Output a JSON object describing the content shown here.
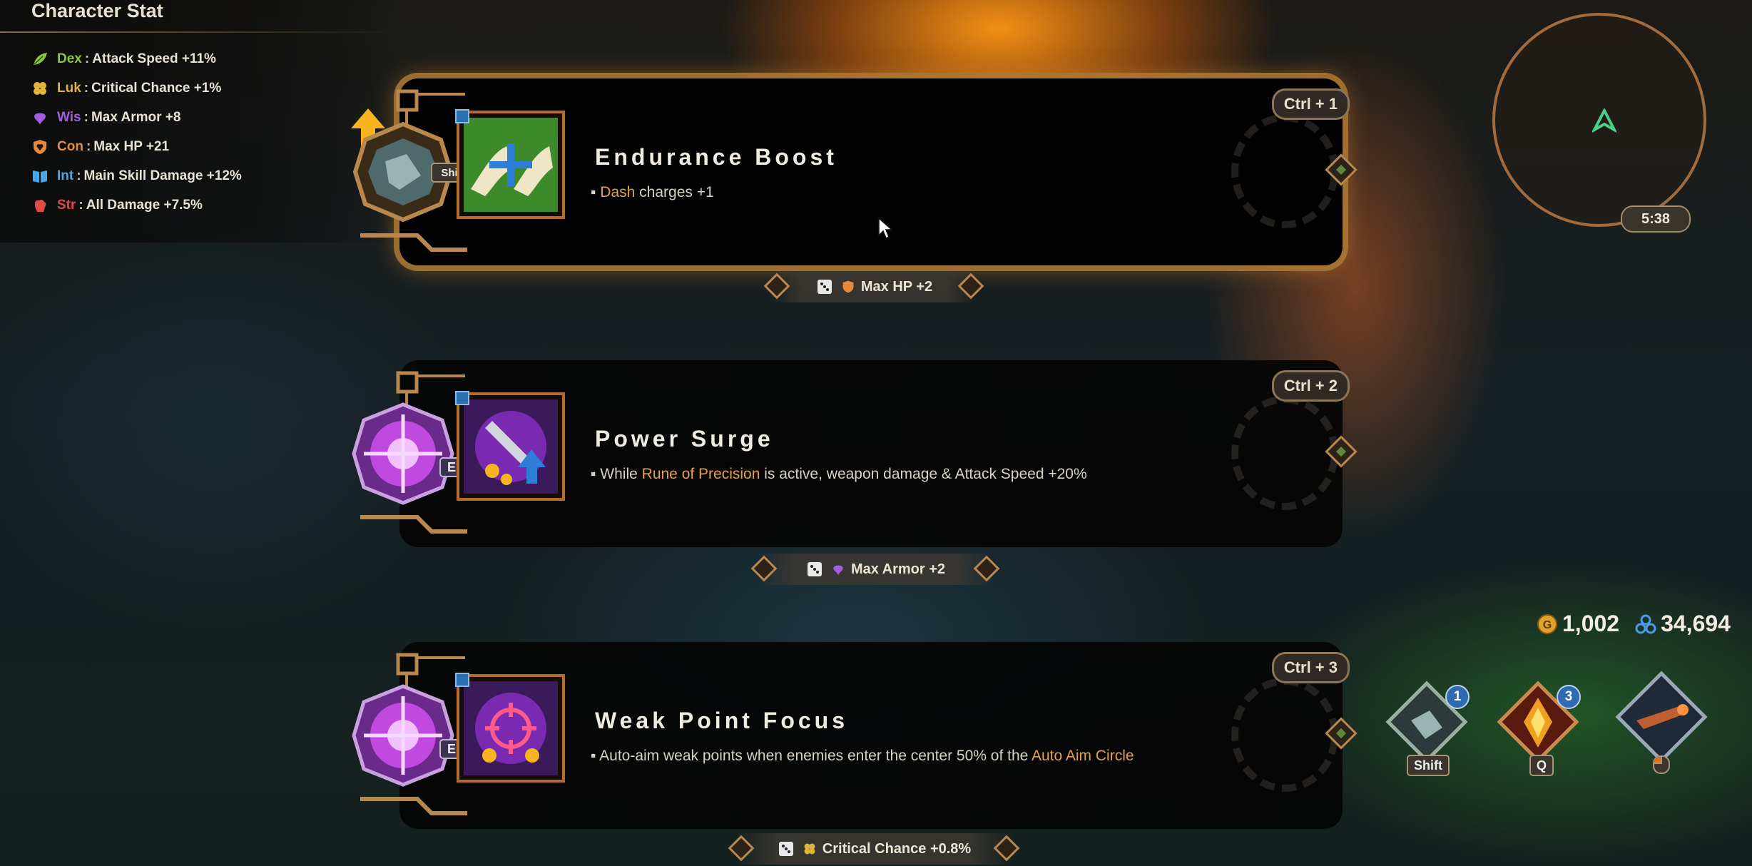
{
  "character_stat": {
    "title": "Character Stat",
    "stats": [
      {
        "abbr": "Dex",
        "separator": ":",
        "effect": "Attack Speed +11%",
        "color": "#8cc63f",
        "icon": "leaf-icon"
      },
      {
        "abbr": "Luk",
        "separator": ":",
        "effect": "Critical Chance +1%",
        "color": "#e0b23a",
        "icon": "clover-icon"
      },
      {
        "abbr": "Wis",
        "separator": ":",
        "effect": "Max Armor +8",
        "color": "#a35de0",
        "icon": "wisdom-icon"
      },
      {
        "abbr": "Con",
        "separator": ":",
        "effect": "Max HP +21",
        "color": "#e58a3a",
        "icon": "shield-heart-icon"
      },
      {
        "abbr": "Int",
        "separator": ":",
        "effect": "Main Skill Damage +12%",
        "color": "#4aa6e6",
        "icon": "book-icon"
      },
      {
        "abbr": "Str",
        "separator": ":",
        "effect": "All Damage +7.5%",
        "color": "#e04a4a",
        "icon": "fist-icon"
      }
    ]
  },
  "cards": [
    {
      "title": "Endurance Boost",
      "hotkey": "Ctrl + 1",
      "desc_bullet": "▪",
      "desc_pre": "",
      "desc_highlight": "Dash",
      "desc_post": " charges +1",
      "gem_key": "Shift",
      "bonus": {
        "stat_icon": "shield-heart-icon",
        "text": "Max HP +2"
      }
    },
    {
      "title": "Power Surge",
      "hotkey": "Ctrl + 2",
      "desc_bullet": "▪",
      "desc_pre": "While ",
      "desc_highlight": "Rune of Precision",
      "desc_post": " is active, weapon damage & Attack Speed +20%",
      "gem_key": "E",
      "bonus": {
        "stat_icon": "wisdom-icon",
        "text": "Max Armor +2"
      }
    },
    {
      "title": "Weak Point Focus",
      "hotkey": "Ctrl + 3",
      "desc_bullet": "▪",
      "desc_pre": "Auto-aim weak points when enemies enter the center 50% of the ",
      "desc_highlight": "Auto Aim Circle",
      "desc_post": "",
      "gem_key": "E",
      "bonus": {
        "stat_icon": "clover-icon",
        "text": "Critical Chance +0.8%"
      }
    }
  ],
  "minimap": {
    "timer": "5:38"
  },
  "currency": {
    "gold": "1,002",
    "crystals": "34,694"
  },
  "skill_bar": [
    {
      "key": "Shift",
      "count": "1",
      "icon": "dash-boot-icon"
    },
    {
      "key": "Q",
      "count": "3",
      "icon": "flame-crystal-icon"
    },
    {
      "key": "",
      "count": "",
      "icon": "weapon-icon"
    }
  ],
  "colors": {
    "accent_gold": "#e5a14a",
    "frame_bronze": "#b9884c",
    "selected_glow": "#ffa03c"
  }
}
